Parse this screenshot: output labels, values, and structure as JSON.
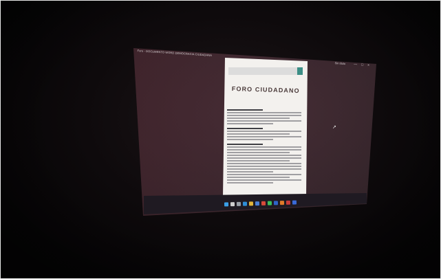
{
  "window": {
    "title": "Foro - DOCUMENTO WORD DEMOCRACIA CIUDADANA",
    "zoom_label": "Sin título",
    "controls": {
      "minimize": "—",
      "maximize": "□",
      "close": "×"
    }
  },
  "document": {
    "title": "FORO CIUDADANO",
    "header_accent_color": "#3c8e86"
  },
  "taskbar": {
    "icons": [
      {
        "name": "windows-start-icon",
        "color": "#3aa0e8"
      },
      {
        "name": "search-icon",
        "color": "#d0d0d0"
      },
      {
        "name": "task-view-icon",
        "color": "#9aa0a8"
      },
      {
        "name": "edge-browser-icon",
        "color": "#2f8fd8"
      },
      {
        "name": "file-explorer-icon",
        "color": "#e2b43a"
      },
      {
        "name": "store-icon",
        "color": "#4a7fd6"
      },
      {
        "name": "chrome-icon",
        "color": "#d84a3a"
      },
      {
        "name": "spotify-icon",
        "color": "#3bbf5a"
      },
      {
        "name": "word-icon",
        "color": "#2f64c8"
      },
      {
        "name": "app-icon-orange",
        "color": "#e07a2a"
      },
      {
        "name": "app-icon-red",
        "color": "#c83a3a"
      },
      {
        "name": "app-icon-blue",
        "color": "#3a6ad8"
      }
    ],
    "tray_time": "",
    "tray_date": ""
  }
}
